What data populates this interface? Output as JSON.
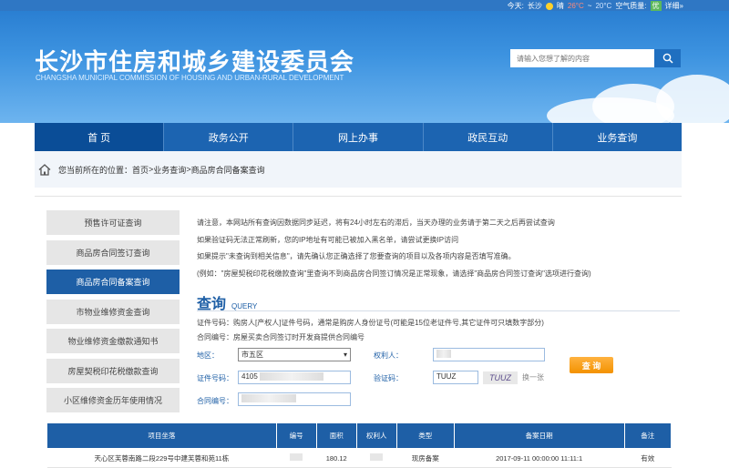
{
  "topbar": {
    "today_label": "今天:",
    "city": "长沙",
    "weather_text": "晴",
    "temp_high": "26°C",
    "temp_low": "20°C",
    "air_label": "空气质量:",
    "air_value": "优",
    "detail_link": "详细»",
    "colors": {
      "strip": "#2f77c4",
      "aq_badge": "#5cb85c"
    }
  },
  "header": {
    "title": "长沙市住房和城乡建设委员会",
    "subtitle": "CHANGSHA MUNICIPAL COMMISSION OF HOUSING AND URBAN-RURAL DEVELOPMENT",
    "search_placeholder": "请输入您想了解的内容",
    "search_icon": "magnifier-icon"
  },
  "nav": {
    "items": [
      "首 页",
      "政务公开",
      "网上办事",
      "政民互动",
      "业务查询"
    ]
  },
  "breadcrumb": {
    "prefix": "您当前所在的位置：",
    "home": "首页",
    "sep1": " > ",
    "level1": "业务查询",
    "sep2": " > ",
    "current": "商品房合同备案查询"
  },
  "sidebar": {
    "items": [
      "预售许可证查询",
      "商品房合同签订查询",
      "商品房合同备案查询",
      "市物业维修资金查询",
      "物业维修资金缴款通知书",
      "房屋契税印花税缴款查询",
      "小区维修资金历年使用情况"
    ],
    "active_index": 2
  },
  "notes": [
    "请注意，本网站所有查询因数据同步延迟，将有24小时左右的滞后，当天办理的业务请于第二天之后再尝试查询",
    "如果验证码无法正常刷新，您的IP地址有可能已被加入黑名单，请尝试更换IP访问",
    "如果提示\"未查询到相关信息\"，请先确认您正确选择了您要查询的项目以及各项内容是否填写准确。",
    "(例如：\"房屋契税印花税缴款查询\"里查询不到商品房合同签订情况是正常现象，请选择\"商品房合同签订查询\"选项进行查询)"
  ],
  "query": {
    "title_cn": "查询",
    "title_en": "QUERY",
    "hint_id": "证件号码：购房人[产权人]证件号码，通常是购房人身份证号(可能是15位老证件号,其它证件可只填数字部分)",
    "hint_contract": "合同编号：房屋买卖合同签订时开发商提供合同编号",
    "district_label": "地区：",
    "district_value": "市五区",
    "owner_label": "权利人：",
    "id_label": "证件号码：",
    "id_value": "4105",
    "captcha_label": "验证码：",
    "captcha_input": "TUUZ",
    "captcha_image_text": "TUUZ",
    "refresh_label": "换一张",
    "contract_label": "合同编号：",
    "submit_label": "查 询"
  },
  "result_table": {
    "headers": [
      "项目坐落",
      "编号",
      "面积",
      "权利人",
      "类型",
      "备案日期",
      "备注"
    ],
    "rows": [
      [
        "天心区芙蓉南路二段229号中建芙蓉和苑11栋",
        "",
        "180.12",
        "",
        "现房备案",
        "2017-09-11 00:00:00 11:11:1",
        "有效"
      ]
    ]
  }
}
